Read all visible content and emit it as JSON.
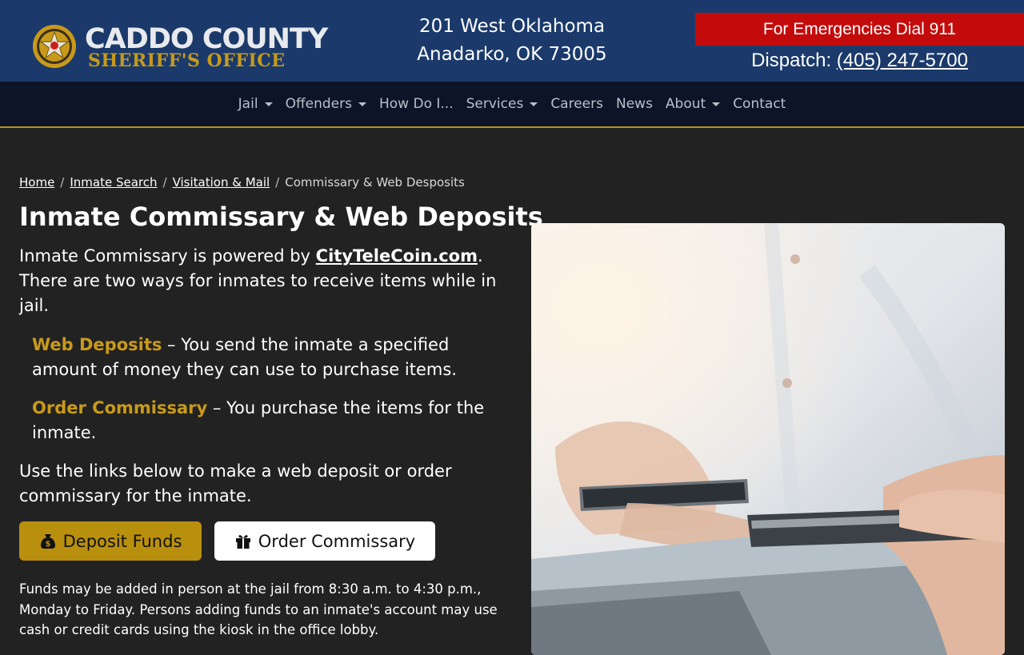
{
  "header": {
    "logo": {
      "line1": "CADDO COUNTY",
      "line2": "SHERIFF'S OFFICE"
    },
    "address": {
      "line1": "201 West Oklahoma",
      "line2": "Anadarko, OK 73005"
    },
    "emergency": "For Emergencies Dial 911",
    "dispatch_label": "Dispatch:",
    "dispatch_phone": "(405) 247-5700"
  },
  "nav": {
    "items": [
      {
        "label": "Jail",
        "dropdown": true
      },
      {
        "label": "Offenders",
        "dropdown": true
      },
      {
        "label": "How Do I...",
        "dropdown": false
      },
      {
        "label": "Services",
        "dropdown": true
      },
      {
        "label": "Careers",
        "dropdown": false
      },
      {
        "label": "News",
        "dropdown": false
      },
      {
        "label": "About",
        "dropdown": true
      },
      {
        "label": "Contact",
        "dropdown": false
      }
    ]
  },
  "breadcrumb": {
    "home": "Home",
    "inmate_search": "Inmate Search",
    "visitation": "Visitation & Mail",
    "current": "Commissary & Web Desposits"
  },
  "main": {
    "title": "Inmate Commissary & Web Deposits",
    "intro_prefix": "Inmate Commissary is powered by ",
    "intro_link": "CityTeleCoin.com",
    "intro_suffix": ". There are two ways for inmates to receive items while in jail.",
    "option1_title": "Web Deposits",
    "option1_text": " – You send the inmate a specified amount of money they can use to purchase items.",
    "option2_title": "Order Commissary",
    "option2_text": " – You purchase the items for the inmate.",
    "links_text": "Use the links below to make a web deposit or order commissary for the inmate.",
    "deposit_button": "Deposit Funds",
    "order_button": "Order Commissary",
    "funds_text": "Funds may be added in person at the jail from 8:30 a.m. to 4:30 p.m., Monday to Friday. Persons adding funds to an inmate's account may use cash or credit cards using the kiosk in the office lobby."
  },
  "colors": {
    "header_bg": "#1b3a6b",
    "nav_bg": "#0c1428",
    "accent_gold": "#c99a1a",
    "emergency_red": "#c40b0b",
    "page_bg": "#222222"
  },
  "icons": {
    "badge": "sheriff-star-badge-icon",
    "deposit": "money-bag-icon",
    "order": "gift-icon",
    "dropdown": "caret-down-icon"
  }
}
